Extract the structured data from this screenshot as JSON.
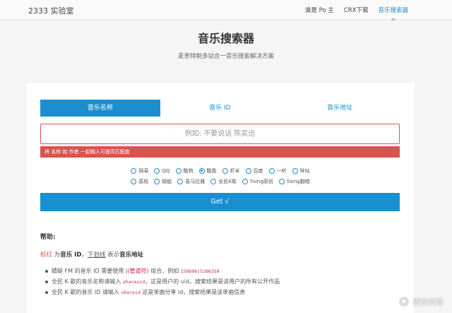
{
  "navbar": {
    "brand": "2333 实验室",
    "items": [
      {
        "label": "谁是 Po 主",
        "active": false
      },
      {
        "label": "CRX下载",
        "active": false
      },
      {
        "label": "音乐搜索器",
        "active": true
      }
    ]
  },
  "header": {
    "title": "音乐搜索器",
    "subtitle": "麦葱特制多站合一音乐搜索解决方案"
  },
  "tabs": [
    {
      "label": "音乐名称",
      "active": true
    },
    {
      "label": "音乐 ID",
      "active": false
    },
    {
      "label": "音乐地址",
      "active": false
    }
  ],
  "search": {
    "placeholder": "例如: 不要说话 陈奕迅",
    "value": ""
  },
  "hint": "将 名称 和 作者 一起输入可提高匹配度",
  "sources_row1": [
    {
      "label": "网易",
      "checked": false
    },
    {
      "label": "QQ",
      "checked": false
    },
    {
      "label": "酷狗",
      "checked": false
    },
    {
      "label": "酷我",
      "checked": true
    },
    {
      "label": "虾米",
      "checked": false
    },
    {
      "label": "百度",
      "checked": false
    },
    {
      "label": "一听",
      "checked": false
    },
    {
      "label": "咪咕",
      "checked": false
    }
  ],
  "sources_row2": [
    {
      "label": "荔枝",
      "checked": false
    },
    {
      "label": "蜻蜓",
      "checked": false
    },
    {
      "label": "喜马拉雅",
      "checked": false
    },
    {
      "label": "全民K歌",
      "checked": false
    },
    {
      "label": "5sing原创",
      "checked": false
    },
    {
      "label": "5sing翻唱",
      "checked": false
    }
  ],
  "get_button": "Get √",
  "help": {
    "title": "帮助:",
    "legend": {
      "red_word": "标红",
      "part1": " 为",
      "bold1": "音乐 ID",
      "part2": "，",
      "underline_word": "下划线",
      "part3": " 表示",
      "bold2": "音乐地址"
    },
    "items": [
      {
        "text1": "蜻蜓 FM 的音乐 ID 需要使用 |",
        "red": "(管道符)",
        "text2": " 组合，例如 ",
        "code": "158696|5266259"
      },
      {
        "text1": "全民 K 歌的音乐名称请输入 ",
        "code": "shareuid",
        "text2": "，这是用户的 uid，搜索结果是该用户的所有公开作品"
      },
      {
        "text1": "全民 K 歌的音乐 ID 请输入 ",
        "code": "shareid",
        "text2": " 这是单曲分享 id，搜索结果是该单曲信息"
      }
    ]
  },
  "watermark": "悟空问答",
  "colors": {
    "accent": "#1a8fd0",
    "danger": "#d9534f"
  }
}
